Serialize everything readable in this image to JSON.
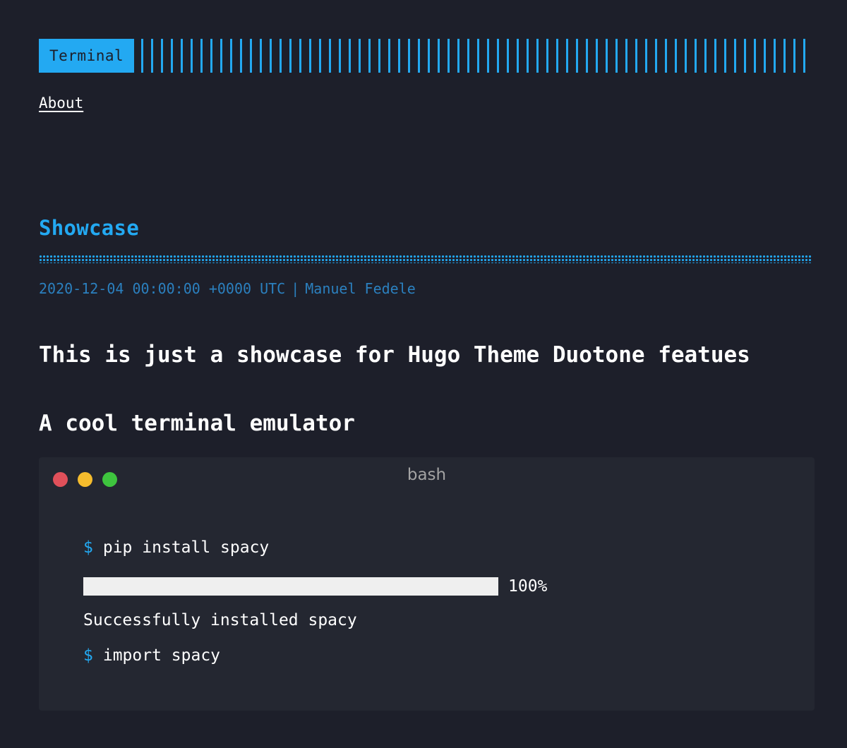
{
  "header": {
    "logo_text": "Terminal",
    "accent_color": "#23a9f2"
  },
  "nav": {
    "items": [
      {
        "label": "About"
      }
    ]
  },
  "post": {
    "title": "Showcase",
    "date": "2020-12-04 00:00:00 +0000 UTC",
    "separator": "|",
    "author": "Manuel Fedele",
    "heading1": "This is just a showcase for Hugo Theme Duotone featues",
    "heading2": "A cool terminal emulator"
  },
  "terminal": {
    "title": "bash",
    "prompt_symbol": "$",
    "lines": [
      {
        "command": "pip install spacy"
      },
      {
        "output": "Successfully installed spacy"
      },
      {
        "command": "import spacy"
      }
    ],
    "progress": {
      "value_fraction": 1.0,
      "label": "100%"
    }
  }
}
